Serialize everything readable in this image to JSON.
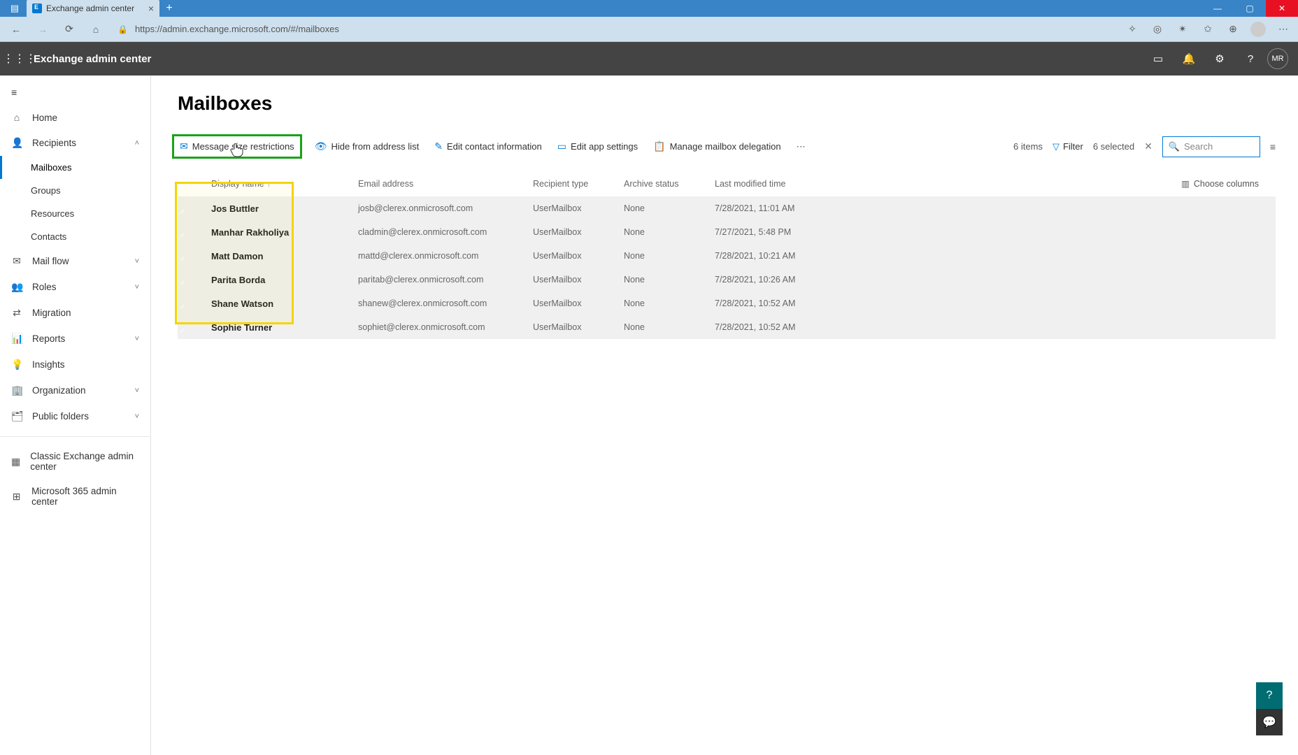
{
  "browser": {
    "tab_title": "Exchange admin center",
    "url": "https://admin.exchange.microsoft.com/#/mailboxes"
  },
  "header": {
    "app_title": "Exchange admin center",
    "avatar_initials": "MR"
  },
  "sidebar": {
    "home": "Home",
    "recipients": "Recipients",
    "mailboxes": "Mailboxes",
    "groups": "Groups",
    "resources": "Resources",
    "contacts": "Contacts",
    "mail_flow": "Mail flow",
    "roles": "Roles",
    "migration": "Migration",
    "reports": "Reports",
    "insights": "Insights",
    "organization": "Organization",
    "public_folders": "Public folders",
    "classic": "Classic Exchange admin center",
    "m365": "Microsoft 365 admin center"
  },
  "page": {
    "title": "Mailboxes"
  },
  "toolbar": {
    "msg_size": "Message size restrictions",
    "hide": "Hide from address list",
    "edit_contact": "Edit contact information",
    "edit_app": "Edit app settings",
    "delegation": "Manage mailbox delegation",
    "items_count": "6 items",
    "filter": "Filter",
    "selected": "6 selected",
    "search_placeholder": "Search"
  },
  "table": {
    "headers": {
      "display_name": "Display name",
      "email": "Email address",
      "recipient_type": "Recipient type",
      "archive": "Archive status",
      "modified": "Last modified time",
      "choose": "Choose columns"
    },
    "rows": [
      {
        "name": "Jos Buttler",
        "email": "josb@clerex.onmicrosoft.com",
        "type": "UserMailbox",
        "archive": "None",
        "modified": "7/28/2021, 11:01 AM"
      },
      {
        "name": "Manhar Rakholiya",
        "email": "cladmin@clerex.onmicrosoft.com",
        "type": "UserMailbox",
        "archive": "None",
        "modified": "7/27/2021, 5:48 PM"
      },
      {
        "name": "Matt Damon",
        "email": "mattd@clerex.onmicrosoft.com",
        "type": "UserMailbox",
        "archive": "None",
        "modified": "7/28/2021, 10:21 AM"
      },
      {
        "name": "Parita Borda",
        "email": "paritab@clerex.onmicrosoft.com",
        "type": "UserMailbox",
        "archive": "None",
        "modified": "7/28/2021, 10:26 AM"
      },
      {
        "name": "Shane Watson",
        "email": "shanew@clerex.onmicrosoft.com",
        "type": "UserMailbox",
        "archive": "None",
        "modified": "7/28/2021, 10:52 AM"
      },
      {
        "name": "Sophie Turner",
        "email": "sophiet@clerex.onmicrosoft.com",
        "type": "UserMailbox",
        "archive": "None",
        "modified": "7/28/2021, 10:52 AM"
      }
    ]
  }
}
